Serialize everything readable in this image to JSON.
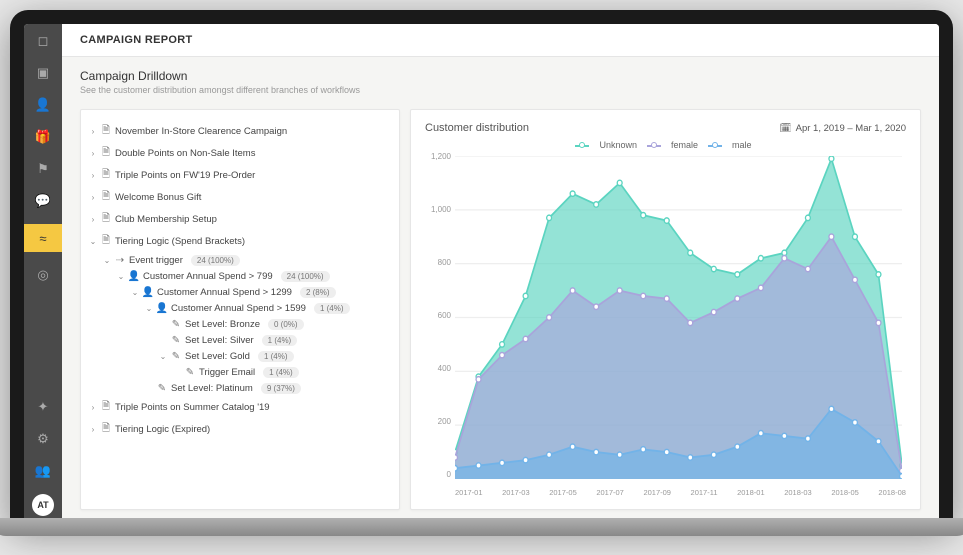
{
  "header": {
    "title": "CAMPAIGN REPORT"
  },
  "sub": {
    "title": "Campaign Drilldown",
    "desc": "See the customer distribution amongst different branches of workflows"
  },
  "avatar": "AT",
  "tree": {
    "items": [
      {
        "label": "November In-Store Clearence Campaign"
      },
      {
        "label": "Double Points on Non-Sale Items"
      },
      {
        "label": "Triple Points on FW'19 Pre-Order"
      },
      {
        "label": "Welcome Bonus Gift"
      },
      {
        "label": "Club Membership Setup"
      },
      {
        "label": "Tiering Logic (Spend Brackets)"
      },
      {
        "label": "Triple Points on Summer Catalog '19"
      },
      {
        "label": "Tiering Logic (Expired)"
      }
    ],
    "sub": {
      "event_trigger": {
        "label": "Event trigger",
        "badge": "24 (100%)"
      },
      "spend799": {
        "label": "Customer Annual Spend > 799",
        "badge": "24 (100%)"
      },
      "spend1299": {
        "label": "Customer Annual Spend > 1299",
        "badge": "2 (8%)"
      },
      "spend1599": {
        "label": "Customer Annual Spend > 1599",
        "badge": "1 (4%)"
      },
      "bronze": {
        "label": "Set Level: Bronze",
        "badge": "0 (0%)"
      },
      "silver": {
        "label": "Set Level: Silver",
        "badge": "1 (4%)"
      },
      "gold": {
        "label": "Set Level: Gold",
        "badge": "1 (4%)"
      },
      "trigger_email": {
        "label": "Trigger Email",
        "badge": "1 (4%)"
      },
      "platinum": {
        "label": "Set Level: Platinum",
        "badge": "9 (37%)"
      }
    }
  },
  "chart": {
    "title": "Customer distribution",
    "date_range": "Apr 1, 2019 – Mar 1, 2020",
    "legend": {
      "unknown": "Unknown",
      "female": "female",
      "male": "male"
    }
  },
  "colors": {
    "unknown": "#5bd4c0",
    "female": "#a9a4db",
    "male": "#72b3e8"
  },
  "chart_data": {
    "type": "area",
    "x": [
      "2017-01",
      "2017-02",
      "2017-03",
      "2017-04",
      "2017-05",
      "2017-06",
      "2017-07",
      "2017-08",
      "2017-09",
      "2017-10",
      "2017-11",
      "2017-12",
      "2018-01",
      "2018-02",
      "2018-03",
      "2018-04",
      "2018-05",
      "2018-06",
      "2018-07",
      "2018-08"
    ],
    "x_ticks": [
      "2017-01",
      "2017-03",
      "2017-05",
      "2017-07",
      "2017-09",
      "2017-11",
      "2018-01",
      "2018-03",
      "2018-05",
      "2018-08"
    ],
    "ylim": [
      0,
      1200
    ],
    "y_ticks": [
      0,
      200,
      400,
      600,
      800,
      1000,
      1200
    ],
    "series": [
      {
        "name": "Unknown",
        "color": "#5bd4c0",
        "values": [
          100,
          380,
          500,
          680,
          970,
          1060,
          1020,
          1100,
          980,
          960,
          840,
          780,
          760,
          820,
          840,
          970,
          1190,
          900,
          760,
          50
        ]
      },
      {
        "name": "female",
        "color": "#a9a4db",
        "values": [
          80,
          370,
          460,
          520,
          600,
          700,
          640,
          700,
          680,
          670,
          580,
          620,
          670,
          710,
          820,
          780,
          900,
          740,
          580,
          30
        ]
      },
      {
        "name": "male",
        "color": "#72b3e8",
        "values": [
          40,
          50,
          60,
          70,
          90,
          120,
          100,
          90,
          110,
          100,
          80,
          90,
          120,
          170,
          160,
          150,
          260,
          210,
          140,
          10
        ]
      }
    ],
    "title": "Customer distribution",
    "xlabel": "",
    "ylabel": ""
  }
}
